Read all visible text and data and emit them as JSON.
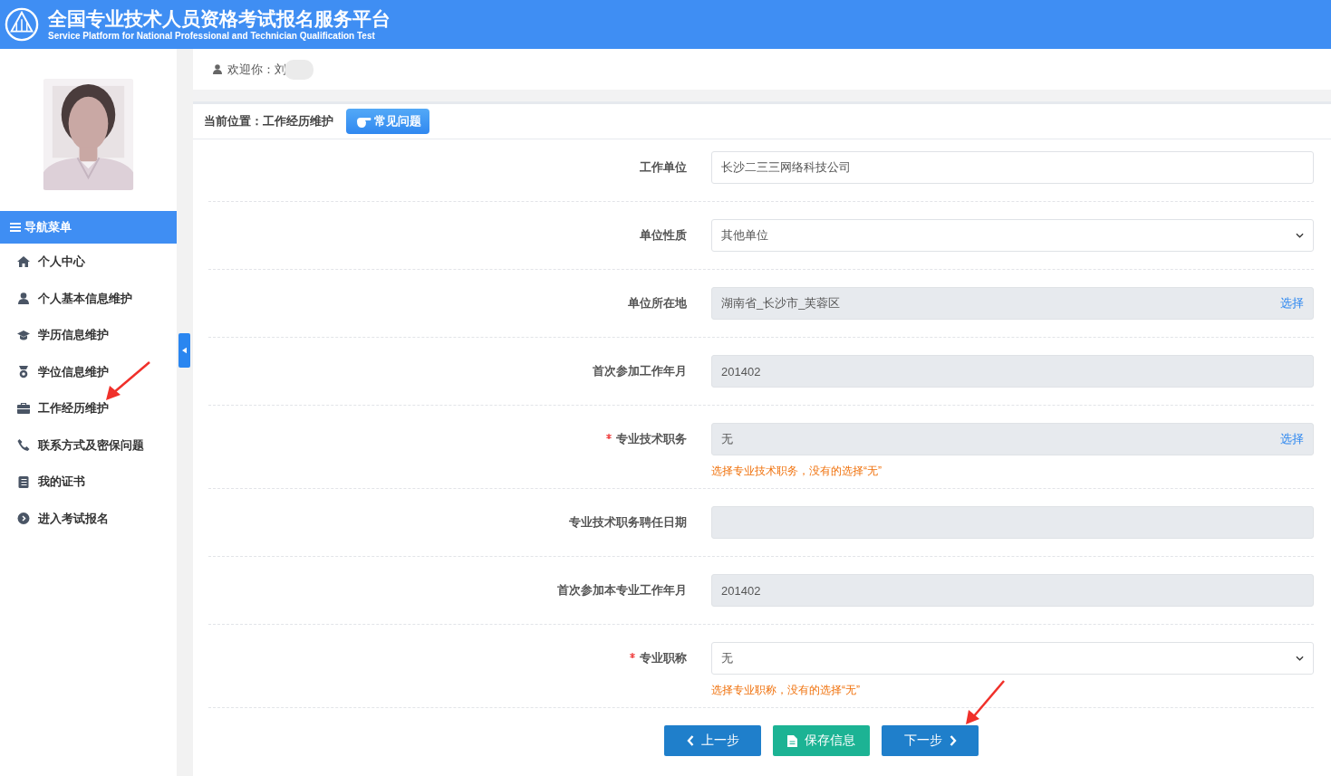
{
  "header": {
    "title": "全国专业技术人员资格考试报名服务平台",
    "subtitle": "Service Platform for National Professional and Technician Qualification Test"
  },
  "welcome": {
    "text": "欢迎你：刘"
  },
  "sidebar": {
    "nav_title": "导航菜单",
    "items": [
      {
        "label": "个人中心"
      },
      {
        "label": "个人基本信息维护"
      },
      {
        "label": "学历信息维护"
      },
      {
        "label": "学位信息维护"
      },
      {
        "label": "工作经历维护"
      },
      {
        "label": "联系方式及密保问题"
      },
      {
        "label": "我的证书"
      },
      {
        "label": "进入考试报名"
      }
    ]
  },
  "breadcrumb": {
    "text": "当前位置：工作经历维护",
    "faq_button": "常见问题"
  },
  "fields": [
    {
      "label": "工作单位",
      "required": false,
      "kind": "text",
      "value": "长沙二三三网络科技公司"
    },
    {
      "label": "单位性质",
      "required": false,
      "kind": "select",
      "value": "其他单位"
    },
    {
      "label": "单位所在地",
      "required": false,
      "kind": "readonly",
      "value": "湖南省_长沙市_芙蓉区",
      "action": "选择"
    },
    {
      "label": "首次参加工作年月",
      "required": false,
      "kind": "readonly",
      "value": "201402"
    },
    {
      "label": "专业技术职务",
      "required": true,
      "kind": "readonly",
      "value": "无",
      "action": "选择",
      "hint": "选择专业技术职务，没有的选择“无”"
    },
    {
      "label": "专业技术职务聘任日期",
      "required": false,
      "kind": "readonly"
    },
    {
      "label": "首次参加本专业工作年月",
      "required": false,
      "kind": "readonly",
      "value": "201402"
    },
    {
      "label": "专业职称",
      "required": true,
      "kind": "select",
      "value": "无",
      "hint": "选择专业职称，没有的选择“无”"
    }
  ],
  "buttons": [
    {
      "label": "上一步",
      "kind": "prev"
    },
    {
      "label": "保存信息",
      "kind": "save"
    },
    {
      "label": "下一步",
      "kind": "next"
    }
  ]
}
